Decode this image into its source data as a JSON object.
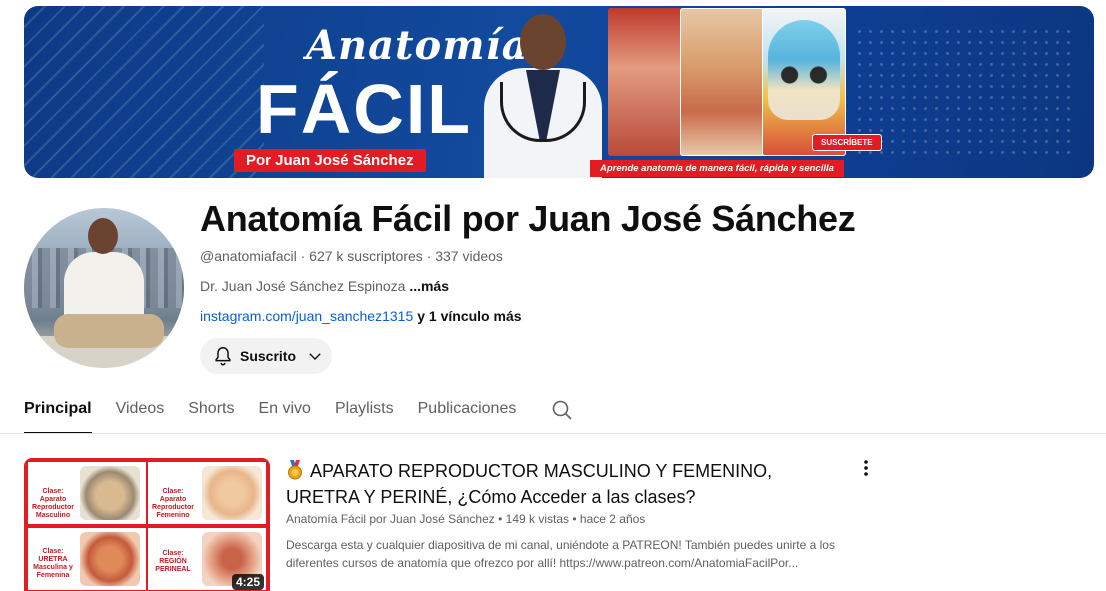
{
  "banner": {
    "script_title": "Anatomía",
    "big_title": "FÁCIL",
    "byline": "Por Juan José Sánchez",
    "subscribe_badge": "SUSCRÍBETE",
    "slogan": "Aprende anatomía de manera fácil, rápida y sencilla"
  },
  "channel": {
    "name": "Anatomía Fácil por Juan José Sánchez",
    "handle": "@anatomiafacil",
    "subscribers": "627 k suscriptores",
    "videos": "337 videos",
    "separator": " · ",
    "description": "Dr. Juan José Sánchez Espinoza ",
    "more_label": "...más",
    "link": "instagram.com/juan_sanchez1315",
    "extra_links": "y 1 vínculo más",
    "subscribed_label": "Suscrito"
  },
  "tabs": [
    {
      "label": "Principal",
      "active": true
    },
    {
      "label": "Videos"
    },
    {
      "label": "Shorts"
    },
    {
      "label": "En vivo"
    },
    {
      "label": "Playlists"
    },
    {
      "label": "Publicaciones"
    }
  ],
  "featured": {
    "title": "APARATO REPRODUCTOR MASCULINO Y FEMENINO, URETRA Y PERINÉ, ¿Cómo Acceder a las clases?",
    "channel": "Anatomía Fácil por Juan José Sánchez",
    "views": "149 k vistas",
    "age": "hace 2 años",
    "dot": " • ",
    "description": "Descarga esta y cualquier diapositiva de mi canal, uniéndote a PATREON! También puedes unirte a los diferentes cursos de anatomía que ofrezco por allí! https://www.patreon.com/AnatomiaFacilPor...",
    "duration": "4:25",
    "thumb_cells": [
      {
        "text": "Clase: Aparato Reproductor Masculino"
      },
      {
        "text": "Clase: Aparato Reproductor Femenino"
      },
      {
        "text": "Clase: URETRA Masculina y Femenina"
      },
      {
        "text": "Clase: REGIÓN PERINEAL"
      }
    ]
  },
  "colors": {
    "accent_red": "#e31b23",
    "link_blue": "#065fd4",
    "banner_blue": "#124a9e"
  },
  "icons": [
    "bell-icon",
    "chevron-down-icon",
    "search-icon",
    "more-vert-icon",
    "medal-icon"
  ]
}
